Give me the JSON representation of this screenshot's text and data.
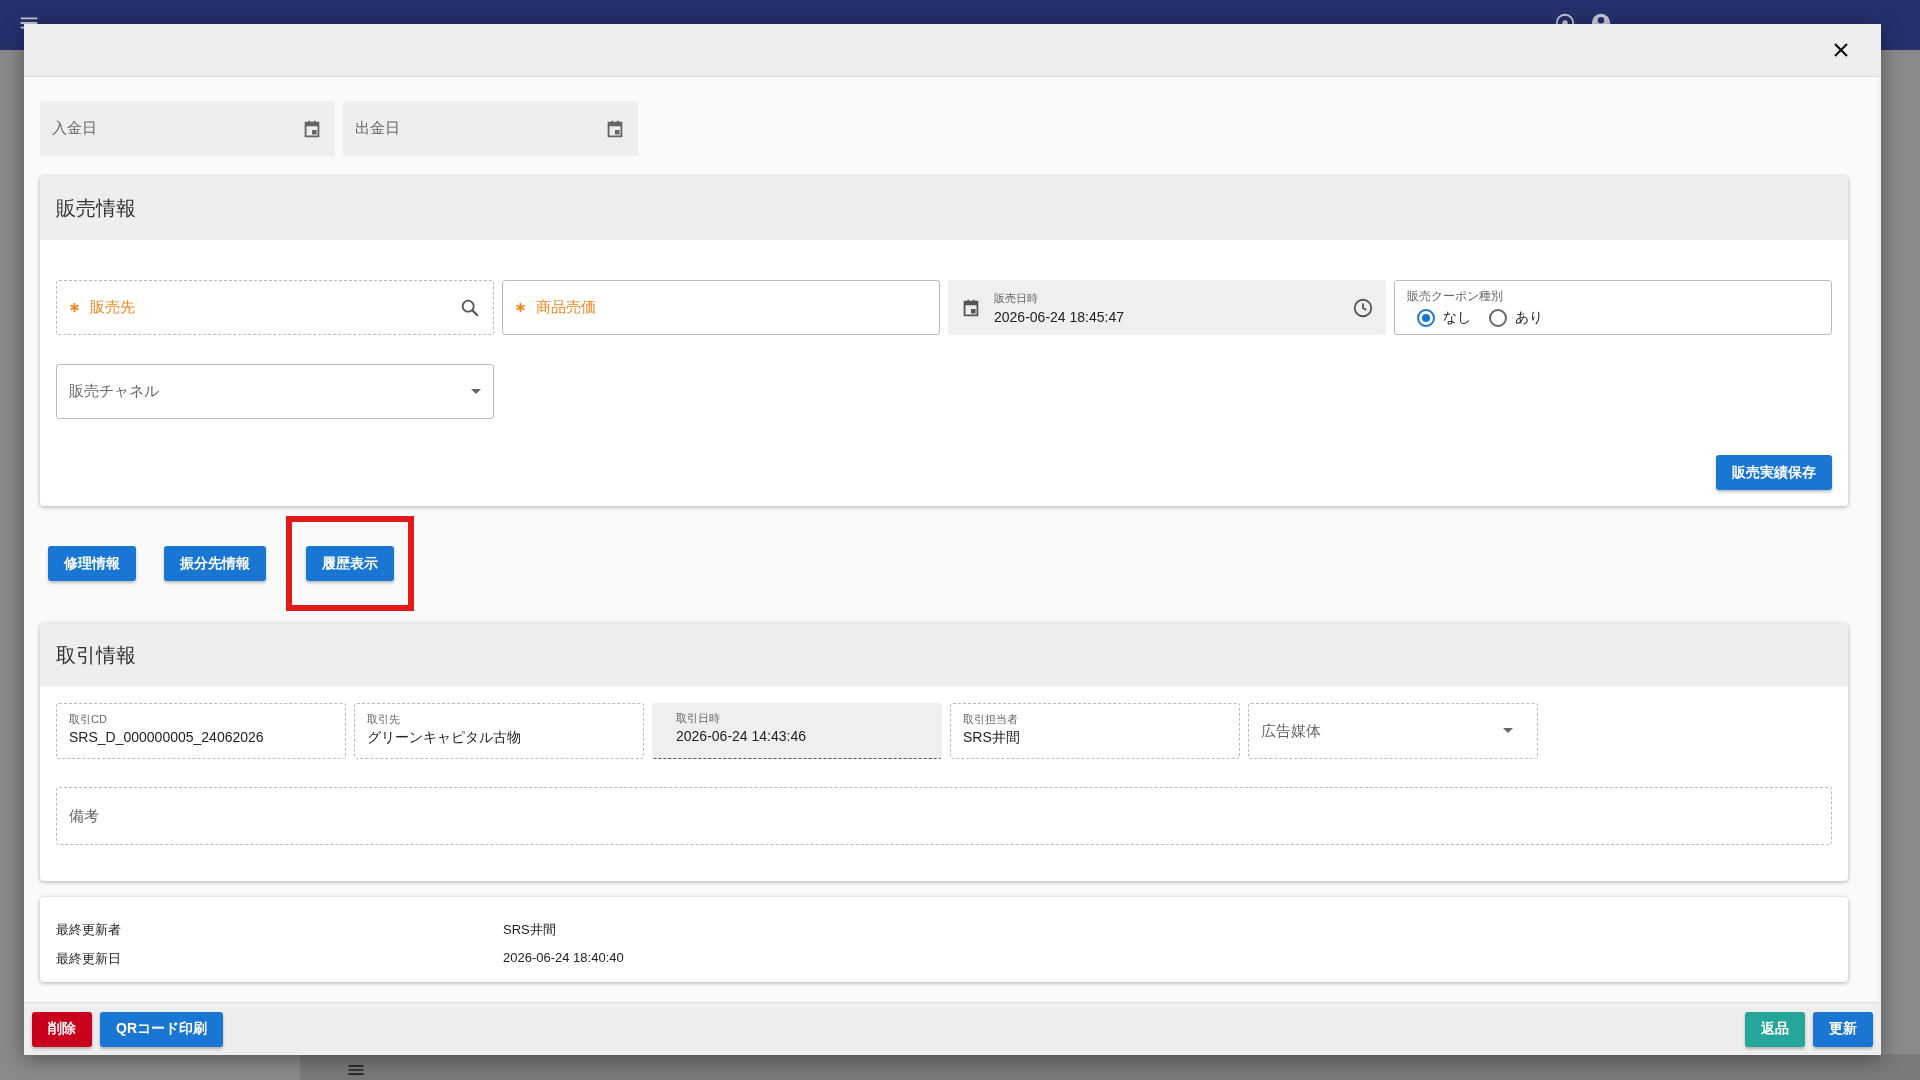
{
  "payment_fields": [
    {
      "label": "入金日"
    },
    {
      "label": "出金日"
    }
  ],
  "sales": {
    "title": "販売情報",
    "fields": [
      {
        "kind": "search",
        "label": "販売先",
        "required": true
      },
      {
        "kind": "text",
        "label": "商品売価",
        "required": true
      },
      {
        "kind": "datetime",
        "label": "販売日時",
        "value": "2026-06-24 18:45:47"
      },
      {
        "kind": "radio",
        "label": "販売クーポン種別",
        "options": [
          {
            "label": "なし",
            "selected": true
          },
          {
            "label": "あり",
            "selected": false
          }
        ]
      },
      {
        "kind": "select",
        "label": "販売チャネル"
      }
    ],
    "save_button": "販売実績保存"
  },
  "action_buttons": [
    {
      "label": "修理情報",
      "highlighted": false
    },
    {
      "label": "振分先情報",
      "highlighted": false
    },
    {
      "label": "履歴表示",
      "highlighted": true
    }
  ],
  "transaction": {
    "title": "取引情報",
    "fields": [
      {
        "kind": "text",
        "label": "取引CD",
        "value": "SRS_D_000000005_24062026"
      },
      {
        "kind": "text",
        "label": "取引先",
        "value": "グリーンキャピタル古物"
      },
      {
        "kind": "readonly",
        "label": "取引日時",
        "value": "2026-06-24 14:43:46"
      },
      {
        "kind": "text",
        "label": "取引担当者",
        "value": "SRS井間"
      },
      {
        "kind": "select",
        "label": "広告媒体"
      }
    ],
    "remarks": {
      "placeholder": "備考"
    }
  },
  "update_info": [
    {
      "label": "最終更新者",
      "value": "SRS井間"
    },
    {
      "label": "最終更新日",
      "value": "2026-06-24 18:40:40"
    }
  ],
  "footer": {
    "left": [
      {
        "kind": "danger",
        "label": "削除"
      },
      {
        "kind": "primary",
        "label": "QRコード印刷"
      }
    ],
    "right": [
      {
        "kind": "teal",
        "label": "返品"
      },
      {
        "kind": "primary",
        "label": "更新"
      }
    ]
  }
}
